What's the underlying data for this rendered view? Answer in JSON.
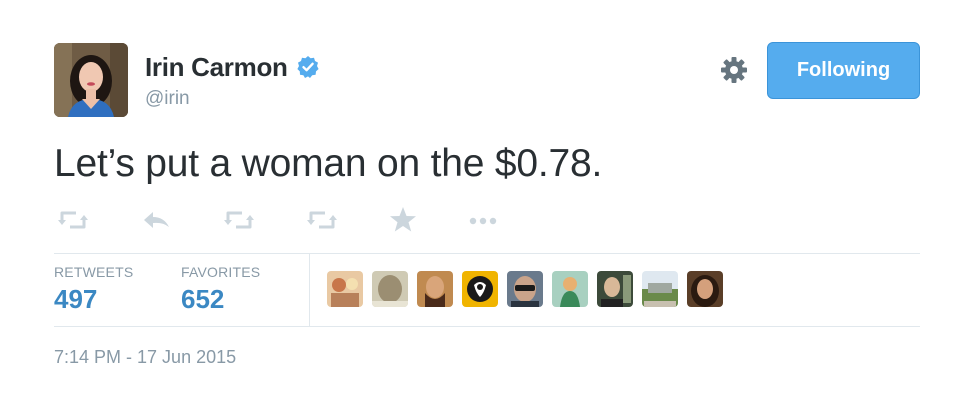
{
  "author": {
    "display_name": "Irin Carmon",
    "handle": "@irin",
    "verified": true,
    "avatar_icon": "profile-photo"
  },
  "follow_button": {
    "label": "Following",
    "color": "#55acee"
  },
  "settings_icon": "gear-icon",
  "tweet": {
    "text": "Let’s put a woman on the $0.78."
  },
  "actions": [
    {
      "name": "retweet-icon"
    },
    {
      "name": "reply-icon"
    },
    {
      "name": "retweet-icon"
    },
    {
      "name": "retweet-icon"
    },
    {
      "name": "favorite-star-icon"
    },
    {
      "name": "more-dots-icon"
    }
  ],
  "stats": {
    "retweets_label": "RETWEETS",
    "retweets_count": "497",
    "favorites_label": "FAVORITES",
    "favorites_count": "652"
  },
  "favoriters": [
    {
      "name": "favoriter-avatar-1",
      "color": "#d8a878"
    },
    {
      "name": "favoriter-avatar-2",
      "color": "#a9a48e"
    },
    {
      "name": "favoriter-avatar-3",
      "color": "#7a4a2e"
    },
    {
      "name": "favoriter-avatar-4",
      "color": "#f0b400"
    },
    {
      "name": "favoriter-avatar-5",
      "color": "#3a4654"
    },
    {
      "name": "favoriter-avatar-6",
      "color": "#7fb3a0"
    },
    {
      "name": "favoriter-avatar-7",
      "color": "#5f6f5a"
    },
    {
      "name": "favoriter-avatar-8",
      "color": "#7a9a5c"
    },
    {
      "name": "favoriter-avatar-9",
      "color": "#4a3424"
    }
  ],
  "timestamp": "7:14 PM - 17 Jun 2015",
  "colors": {
    "link_blue": "#3b88c3",
    "muted_gray": "#8899a6",
    "text_dark": "#292f33",
    "divider": "#e1e8ed"
  }
}
